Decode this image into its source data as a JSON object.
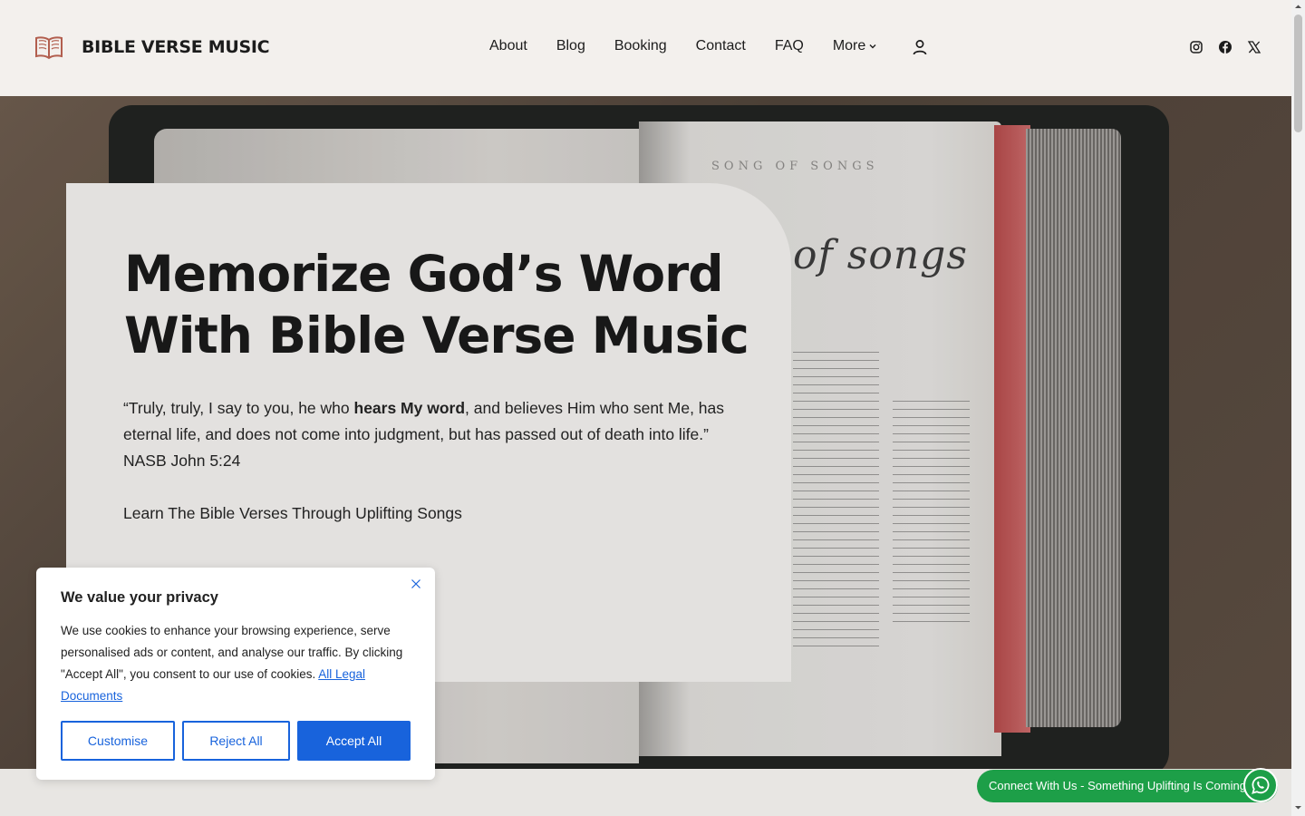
{
  "brand": {
    "name": "BIBLE VERSE MUSIC",
    "icon": "open-book-icon"
  },
  "nav": {
    "items": [
      {
        "label": "About"
      },
      {
        "label": "Blog"
      },
      {
        "label": "Booking"
      },
      {
        "label": "Contact"
      },
      {
        "label": "FAQ"
      },
      {
        "label": "More"
      }
    ],
    "account_icon": "user-icon"
  },
  "socials": [
    "instagram-icon",
    "facebook-icon",
    "x-icon"
  ],
  "hero": {
    "headline_line1": "Memorize God’s Word",
    "headline_line2": "With Bible Verse Music",
    "quote_part1": "“Truly, truly, I say to you, he who ",
    "quote_bold": "hears My word",
    "quote_part2": ", and believes Him who sent Me, has eternal life, and does not come into judgment, but has passed out of death into life.” NASB John 5:24",
    "tagline": "Learn The Bible Verses Through Uplifting Songs",
    "background_book_text": "of songs",
    "background_page_head": "SONG OF SONGS"
  },
  "cookie": {
    "title": "We value your privacy",
    "body": "We use cookies to enhance your browsing experience, serve personalised ads or content, and analyse our traffic. By clicking \"Accept All\", you consent to our use of cookies. ",
    "link": "All Legal Documents",
    "customise": "Customise",
    "reject": "Reject All",
    "accept": "Accept All"
  },
  "whatsapp": {
    "label": "Connect With Us - Something Uplifting Is Coming"
  },
  "colors": {
    "accent": "#1863dc",
    "whatsapp": "#1d9f48",
    "header_bg": "#f3f0ed",
    "card_bg": "#e3e1df",
    "logo": "#b25e4e"
  }
}
